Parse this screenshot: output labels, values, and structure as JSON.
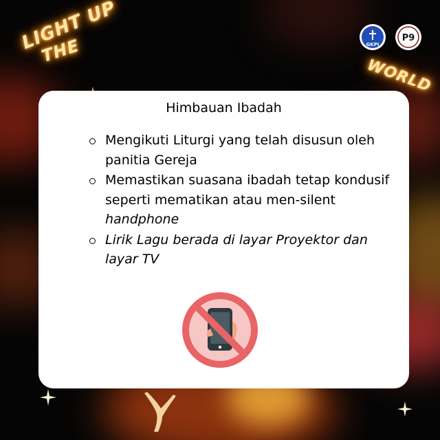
{
  "neon_text": {
    "line1": "LIGHT UP",
    "line2": "THE",
    "line3": "WORLD"
  },
  "logos": {
    "left_label": "GKPI",
    "right_label": "P9"
  },
  "card": {
    "title": "Himbauan Ibadah",
    "items": [
      {
        "text": "Mengikuti Liturgi yang telah disusun oleh panitia Gereja",
        "emphasis": ""
      },
      {
        "text": "Memastikan suasana ibadah tetap kondusif seperti mematikan atau men-silent ",
        "emphasis": "handphone"
      },
      {
        "text": "Lirik Lagu berada di layar Proyektor dan layar TV",
        "emphasis": ""
      }
    ],
    "icon": "no-phone-icon"
  },
  "colors": {
    "card_bg": "#ffffff",
    "background": "#050505",
    "neon": "#ffb84d",
    "prohibition_red": "#e86466",
    "prohibition_fill": "#f6c7c5",
    "phone_dark": "#2d3a3f"
  }
}
